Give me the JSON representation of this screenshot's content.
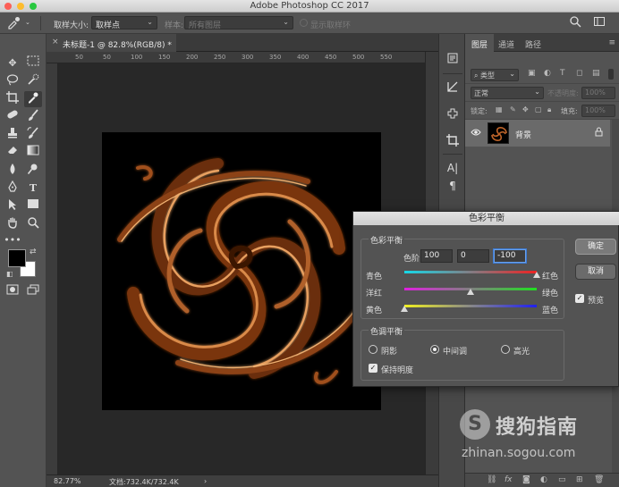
{
  "app_title": "Adobe Photoshop CC 2017",
  "options_bar": {
    "sample_size_label": "取样大小:",
    "sample_size_value": "取样点",
    "sample_label": "样本:",
    "sample_value": "所有图层",
    "show_ring_label": "显示取样环"
  },
  "document": {
    "tab_label": "未标题-1 @ 82.8%(RGB/8) *",
    "close_glyph": "×",
    "ruler_ticks": [
      "50",
      "50",
      "100",
      "150",
      "200",
      "250",
      "300",
      "350",
      "400",
      "450",
      "500",
      "550"
    ],
    "zoom": "82.77%",
    "doc_info": "文档:732.4K/732.4K"
  },
  "layers_panel": {
    "tabs": [
      "图层",
      "通道",
      "路径"
    ],
    "filter_label": "类型",
    "blend_mode": "正常",
    "opacity_label": "不透明度:",
    "opacity_value": "100%",
    "lock_label": "锁定:",
    "fill_label": "填充:",
    "fill_value": "100%",
    "layer_name": "背景"
  },
  "dialog": {
    "title": "色彩平衡",
    "color_balance_group": "色彩平衡",
    "levels_label": "色阶:",
    "levels": [
      "100",
      "0",
      "-100"
    ],
    "slider_rows": [
      {
        "left": "青色",
        "right": "红色",
        "value": 100
      },
      {
        "left": "洋红",
        "right": "绿色",
        "value": 0
      },
      {
        "left": "黄色",
        "right": "蓝色",
        "value": -100
      }
    ],
    "tone_group": "色调平衡",
    "tones": [
      "阴影",
      "中间调",
      "高光"
    ],
    "selected_tone": "中间调",
    "preserve_luminosity": "保持明度",
    "preview": "预览",
    "ok": "确定",
    "cancel": "取消"
  },
  "watermark": {
    "logo_letter": "S",
    "brand": "搜狗指南",
    "url": "zhinan.sogou.com"
  },
  "colors": {
    "foreground": "#000000",
    "background": "#ffffff",
    "swirl": "#c0652a"
  }
}
